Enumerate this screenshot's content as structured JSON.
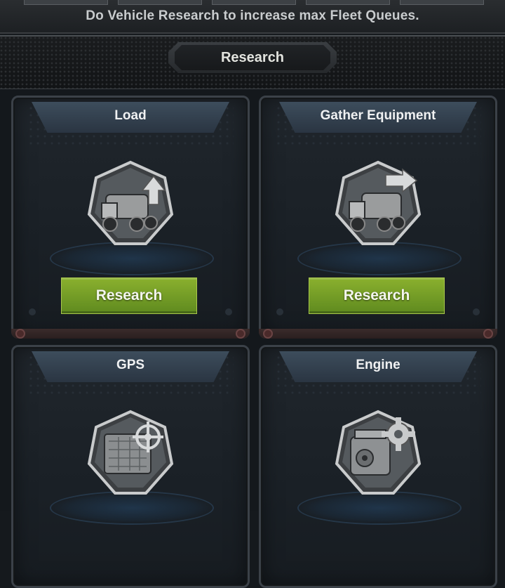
{
  "notice": {
    "text": "Do Vehicle Research to increase max Fleet Queues."
  },
  "header": {
    "title": "Research"
  },
  "cards": [
    {
      "title": "Load",
      "icon": "truck-upgrade-icon",
      "button_label": "Research"
    },
    {
      "title": "Gather Equipment",
      "icon": "truck-gather-icon",
      "button_label": "Research"
    },
    {
      "title": "GPS",
      "icon": "gps-map-icon"
    },
    {
      "title": "Engine",
      "icon": "engine-gear-icon"
    }
  ],
  "colors": {
    "button_green": "#7aa228",
    "card_blue": "#2f3c49"
  }
}
